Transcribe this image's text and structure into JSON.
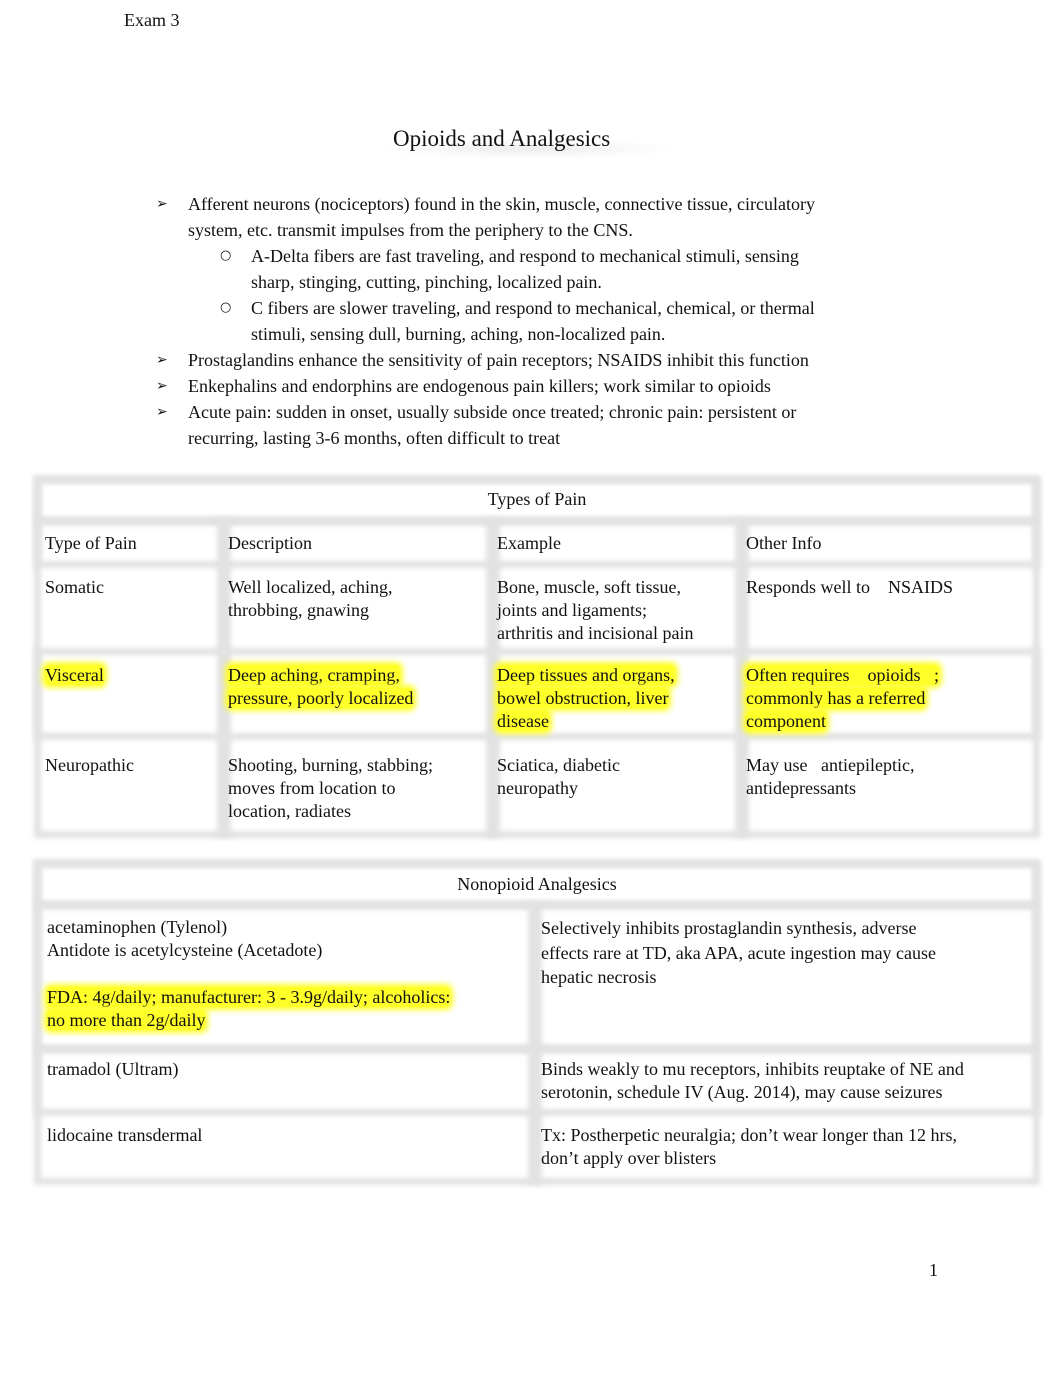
{
  "header": {
    "text": "Exam 3"
  },
  "title": "Opioids and Analgesics",
  "bullets": [
    {
      "text": "Afferent neurons (nociceptors) found in the skin, muscle, connective tissue, circulatory",
      "text2": "system, etc. transmit impulses from the periphery to the CNS.",
      "sub": [
        {
          "text": "A-Delta fibers are fast traveling, and respond to mechanical stimuli, sensing",
          "text2": "sharp, stinging, cutting, pinching, localized pain."
        },
        {
          "text": "C fibers are slower traveling, and respond to mechanical, chemical, or thermal",
          "text2": "stimuli, sensing dull, burning, aching, non-localized pain."
        }
      ]
    },
    {
      "text": "Prostaglandins enhance the sensitivity of pain receptors; NSAIDS inhibit this function"
    },
    {
      "text": "Enkephalins and endorphins are endogenous pain killers; work similar to opioids"
    },
    {
      "text": "Acute pain: sudden in onset, usually subside once treated; chronic pain: persistent or",
      "text2": "recurring, lasting 3-6 months, often difficult to treat"
    }
  ],
  "markers": {
    "arrow": "➢",
    "circle": "○"
  },
  "highlight_color": "#ffff2a",
  "types_of_pain": {
    "title": "Types of Pain",
    "headers": [
      "Type of Pain",
      "Description",
      "Example",
      "Other Info"
    ],
    "rows": [
      {
        "highlighted": false,
        "cells": [
          [
            "Somatic"
          ],
          [
            "Well localized, aching,",
            "throbbing, gnawing"
          ],
          [
            "Bone, muscle, soft tissue,",
            "joints and ligaments;",
            "arthritis and incisional pain"
          ],
          [
            "Responds well to    NSAIDS"
          ]
        ]
      },
      {
        "highlighted": true,
        "cells": [
          [
            "Visceral"
          ],
          [
            "Deep aching, cramping,",
            "pressure, poorly localized"
          ],
          [
            "Deep tissues and organs,",
            "bowel obstruction, liver",
            "disease"
          ],
          [
            "Often requires    opioids   ;",
            "commonly has a referred",
            "component"
          ]
        ]
      },
      {
        "highlighted": false,
        "cells": [
          [
            "Neuropathic"
          ],
          [
            "Shooting, burning, stabbing;",
            "moves from location to",
            "location, radiates"
          ],
          [
            "Sciatica, diabetic",
            "neuropathy"
          ],
          [
            "May use   antiepileptic,",
            "antidepressants"
          ]
        ]
      }
    ]
  },
  "nonopioid": {
    "title": "Nonopioid Analgesics",
    "rows": [
      {
        "drug": [
          "acetaminophen (Tylenol)",
          "Antidote is acetylcysteine (Acetadote)"
        ],
        "drug_highlight": [
          "FDA: 4g/daily; manufacturer: 3 - 3.9g/daily; alcoholics:",
          "no more than 2g/daily"
        ],
        "info": [
          "Selectively inhibits prostaglandin synthesis, adverse",
          "effects rare at TD, aka APA, acute ingestion may cause",
          "hepatic necrosis"
        ]
      },
      {
        "drug": [
          "tramadol (Ultram)"
        ],
        "info": [
          "Binds weakly to mu receptors, inhibits reuptake of NE and",
          "serotonin, schedule IV (Aug. 2014), may cause seizures"
        ]
      },
      {
        "drug": [
          "lidocaine transdermal"
        ],
        "info": [
          "Tx: Postherpetic neuralgia; don’t wear longer than 12 hrs,",
          "don’t apply over blisters"
        ]
      }
    ]
  },
  "page_number": "1"
}
